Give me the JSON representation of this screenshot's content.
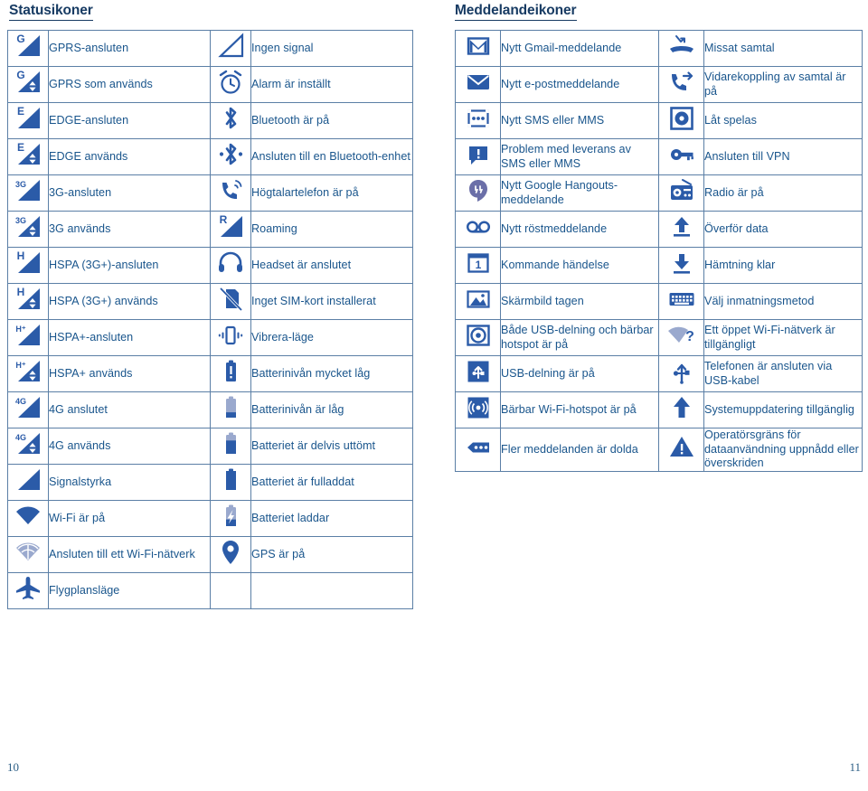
{
  "headings": {
    "status": "Statusikoner",
    "notifications": "Meddelandeikoner"
  },
  "page_numbers": {
    "left": "10",
    "right": "11"
  },
  "colors": {
    "accent_blue": "#2b5ba8",
    "text_blue": "#19558c",
    "heading_navy": "#173b63",
    "border_blue": "#5b7fa6",
    "light_blue": "#9aa9ce"
  },
  "status_table": {
    "rows": [
      {
        "left": {
          "icon": "signal-gprs-connected-icon",
          "label": "GPRS-ansluten"
        },
        "right": {
          "icon": "no-signal-icon",
          "label": "Ingen signal"
        }
      },
      {
        "left": {
          "icon": "signal-gprs-in-use-icon",
          "label": "GPRS som används"
        },
        "right": {
          "icon": "alarm-clock-icon",
          "label": "Alarm är inställt"
        }
      },
      {
        "left": {
          "icon": "signal-edge-connected-icon",
          "label": "EDGE-ansluten"
        },
        "right": {
          "icon": "bluetooth-icon",
          "label": "Bluetooth är på"
        }
      },
      {
        "left": {
          "icon": "signal-edge-in-use-icon",
          "label": "EDGE används"
        },
        "right": {
          "icon": "bluetooth-connected-icon",
          "label": "Ansluten till en Bluetooth-enhet"
        }
      },
      {
        "left": {
          "icon": "signal-3g-connected-icon",
          "label": "3G-ansluten"
        },
        "right": {
          "icon": "speakerphone-icon",
          "label": "Högtalartelefon är på"
        }
      },
      {
        "left": {
          "icon": "signal-3g-in-use-icon",
          "label": "3G används"
        },
        "right": {
          "icon": "roaming-icon",
          "label": "Roaming"
        }
      },
      {
        "left": {
          "icon": "signal-hspa-connected-icon",
          "label": "HSPA (3G+)-ansluten"
        },
        "right": {
          "icon": "headset-icon",
          "label": "Headset är anslutet"
        }
      },
      {
        "left": {
          "icon": "signal-hspa-in-use-icon",
          "label": "HSPA (3G+) används"
        },
        "right": {
          "icon": "no-sim-card-icon",
          "label": "Inget SIM-kort installerat"
        }
      },
      {
        "left": {
          "icon": "signal-hspa-plus-connected-icon",
          "label": "HSPA+-ansluten"
        },
        "right": {
          "icon": "vibrate-icon",
          "label": "Vibrera-läge"
        }
      },
      {
        "left": {
          "icon": "signal-hspa-plus-in-use-icon",
          "label": "HSPA+ används"
        },
        "right": {
          "icon": "battery-very-low-icon",
          "label": "Batterinivån mycket låg"
        }
      },
      {
        "left": {
          "icon": "signal-4g-connected-icon",
          "label": "4G anslutet"
        },
        "right": {
          "icon": "battery-low-icon",
          "label": "Batterinivån är låg"
        }
      },
      {
        "left": {
          "icon": "signal-4g-in-use-icon",
          "label": "4G används"
        },
        "right": {
          "icon": "battery-partially-drained-icon",
          "label": "Batteriet är delvis uttömt"
        }
      },
      {
        "left": {
          "icon": "signal-strength-icon",
          "label": "Signalstyrka"
        },
        "right": {
          "icon": "battery-full-icon",
          "label": "Batteriet är fulladdat"
        }
      },
      {
        "left": {
          "icon": "wifi-on-icon",
          "label": "Wi-Fi är på"
        },
        "right": {
          "icon": "battery-charging-icon",
          "label": "Batteriet laddar"
        }
      },
      {
        "left": {
          "icon": "wifi-connected-icon",
          "label": "Ansluten till ett Wi-Fi-nätverk"
        },
        "right": {
          "icon": "gps-icon",
          "label": "GPS är på"
        }
      },
      {
        "left": {
          "icon": "airplane-mode-icon",
          "label": "Flygplansläge"
        },
        "right": {
          "icon": "",
          "label": ""
        }
      }
    ]
  },
  "notification_table": {
    "rows": [
      {
        "left": {
          "icon": "gmail-icon",
          "label": "Nytt Gmail-meddelande"
        },
        "right": {
          "icon": "missed-call-icon",
          "label": "Missat samtal"
        }
      },
      {
        "left": {
          "icon": "email-icon",
          "label": "Nytt e-postmeddelande"
        },
        "right": {
          "icon": "call-forwarding-icon",
          "label": "Vidarekoppling av samtal är på"
        }
      },
      {
        "left": {
          "icon": "sms-mms-icon",
          "label": "Nytt SMS eller MMS"
        },
        "right": {
          "icon": "music-playing-icon",
          "label": "Låt spelas"
        }
      },
      {
        "left": {
          "icon": "sms-problem-icon",
          "label": "Problem med leverans av SMS eller MMS"
        },
        "right": {
          "icon": "vpn-key-icon",
          "label": "Ansluten till VPN"
        }
      },
      {
        "left": {
          "icon": "hangouts-icon",
          "label": "Nytt Google Hangouts-meddelande"
        },
        "right": {
          "icon": "radio-icon",
          "label": "Radio är på"
        }
      },
      {
        "left": {
          "icon": "voicemail-icon",
          "label": "Nytt röstmeddelande"
        },
        "right": {
          "icon": "upload-data-icon",
          "label": "Överför data"
        }
      },
      {
        "left": {
          "icon": "upcoming-event-icon",
          "label": "Kommande händelse"
        },
        "right": {
          "icon": "download-complete-icon",
          "label": "Hämtning klar"
        }
      },
      {
        "left": {
          "icon": "screenshot-icon",
          "label": "Skärmbild tagen"
        },
        "right": {
          "icon": "keyboard-icon",
          "label": "Välj inmatningsmetod"
        }
      },
      {
        "left": {
          "icon": "usb-and-hotspot-icon",
          "label": "Både USB-delning och bärbar hotspot är på"
        },
        "right": {
          "icon": "open-wifi-available-icon",
          "label": "Ett öppet Wi-Fi-nätverk är tillgängligt"
        }
      },
      {
        "left": {
          "icon": "usb-tethering-icon",
          "label": "USB-delning är på"
        },
        "right": {
          "icon": "usb-connected-icon",
          "label": "Telefonen är ansluten via USB-kabel"
        }
      },
      {
        "left": {
          "icon": "portable-hotspot-icon",
          "label": "Bärbar Wi-Fi-hotspot är på"
        },
        "right": {
          "icon": "system-update-icon",
          "label": "Systemuppdatering tillgänglig"
        }
      },
      {
        "left": {
          "icon": "more-notifications-icon",
          "label": "Fler meddelanden är dolda"
        },
        "right": {
          "icon": "data-limit-warning-icon",
          "label": "Operatörsgräns för dataanvändning uppnådd eller överskriden"
        }
      }
    ]
  }
}
